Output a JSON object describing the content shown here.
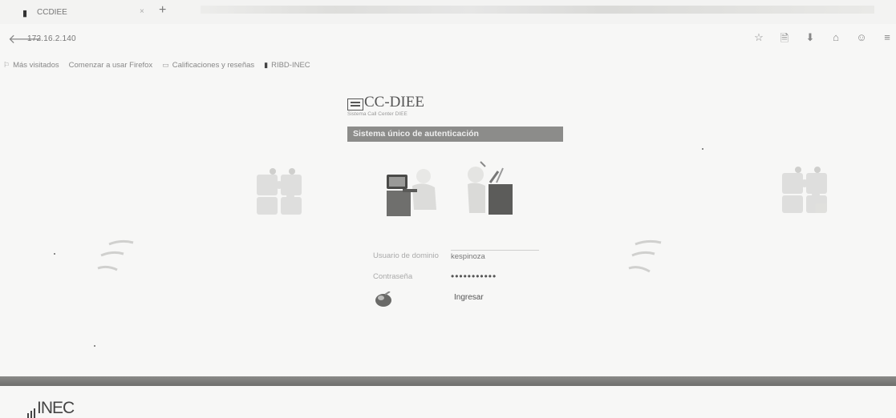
{
  "browser": {
    "tab_title": "CCDIEE",
    "tab_close": "×",
    "new_tab": "+",
    "back": "🡐",
    "url": "172.16.2.140",
    "nav_icons": [
      "☆",
      "🗎",
      "⬇",
      "⌂",
      "☺",
      "≡"
    ]
  },
  "bookmarks": [
    {
      "icon": "⚐",
      "label": "Más visitados"
    },
    {
      "icon": "",
      "label": "Comenzar a usar Firefox"
    },
    {
      "icon": "▭",
      "label": "Calificaciones y reseñas"
    },
    {
      "icon": "▮",
      "label": "RIBD-INEC"
    }
  ],
  "page": {
    "logo_title": "CC-DIEE",
    "logo_subtitle": "Sistema Call Center DIEE",
    "banner": "Sistema único de autenticación",
    "username_label": "Usuario de dominio",
    "username_value": "kespinoza",
    "password_label": "Contraseña",
    "password_value": "•••••••••••",
    "login_button": "Ingresar"
  },
  "footer": {
    "brand": "INEC"
  },
  "colors": {
    "banner": "#8c8c8a",
    "footer_band": "#7a7a78",
    "background": "#f7f7f6"
  }
}
